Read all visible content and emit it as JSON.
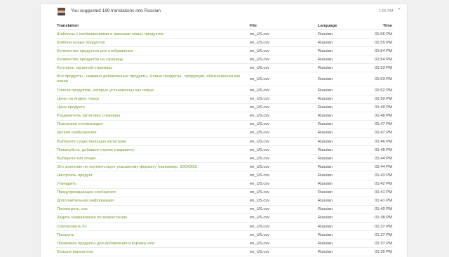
{
  "header": {
    "text": "You suggested 199 translations into Russian",
    "time": "1:56 PM"
  },
  "table": {
    "columns": [
      "Translation",
      "File",
      "Language",
      "Time"
    ],
    "rows": [
      {
        "translation": "Шаблоны с изображениями и именами новых продуктов",
        "file": "en_US.csv",
        "language": "Russian",
        "time": "01:56 PM"
      },
      {
        "translation": "Шаблон новых продуктов",
        "file": "en_US.csv",
        "language": "Russian",
        "time": "01:55 PM"
      },
      {
        "translation": "Количество продуктов для отображения",
        "file": "en_US.csv",
        "language": "Russian",
        "time": "01:54 PM"
      },
      {
        "translation": "Количество продуктов на страницу",
        "file": "en_US.csv",
        "language": "Russian",
        "time": "01:54 PM"
      },
      {
        "translation": "Контроль экранной страницы",
        "file": "en_US.csv",
        "language": "Russian",
        "time": "01:53 PM"
      },
      {
        "translation": "Все продукты - недавно добавленные продукты, Новые продукты - продукция, обозначенная как новая",
        "file": "en_US.csv",
        "language": "Russian",
        "time": "01:53 PM"
      },
      {
        "translation": "Список продуктов, которые установлены как новые",
        "file": "en_US.csv",
        "language": "Russian",
        "time": "01:52 PM"
      },
      {
        "translation": "Цены на индекс товар",
        "file": "en_US.csv",
        "language": "Russian",
        "time": "01:50 PM"
      },
      {
        "translation": "Цена продукта",
        "file": "en_US.csv",
        "language": "Russian",
        "time": "01:49 PM"
      },
      {
        "translation": "Разделитель заголовка страницы",
        "file": "en_US.csv",
        "language": "Russian",
        "time": "01:48 PM"
      },
      {
        "translation": "Поисковая оптимизация",
        "file": "en_US.csv",
        "language": "Russian",
        "time": "01:47 PM"
      },
      {
        "translation": "Детали изображения",
        "file": "en_US.csv",
        "language": "Russian",
        "time": "01:47 PM"
      },
      {
        "translation": "Выберите существующую категорию.",
        "file": "en_US.csv",
        "language": "Russian",
        "time": "01:46 PM"
      },
      {
        "translation": "Пожалуйста, добавьте строки к варианту.",
        "file": "en_US.csv",
        "language": "Russian",
        "time": "01:45 PM"
      },
      {
        "translation": "Выберите тип опции.",
        "file": "en_US.csv",
        "language": "Russian",
        "time": "01:44 PM"
      },
      {
        "translation": "Это значение не соответствует указанному формату (например, 200X300).",
        "file": "en_US.csv",
        "language": "Russian",
        "time": "01:44 PM"
      },
      {
        "translation": "Настроить продукт",
        "file": "en_US.csv",
        "language": "Russian",
        "time": "01:43 PM"
      },
      {
        "translation": "Утвердить",
        "file": "en_US.csv",
        "language": "Russian",
        "time": "01:42 PM"
      },
      {
        "translation": "Предупреждающее сообщение",
        "file": "en_US.csv",
        "language": "Russian",
        "time": "01:41 PM"
      },
      {
        "translation": "Дополнительная информация",
        "file": "en_US.csv",
        "language": "Russian",
        "time": "01:41 PM"
      },
      {
        "translation": "Посмотреть, как",
        "file": "en_US.csv",
        "language": "Russian",
        "time": "01:40 PM"
      },
      {
        "translation": "Задать направление по возрастанию",
        "file": "en_US.csv",
        "language": "Russian",
        "time": "01:38 PM"
      },
      {
        "translation": "Сортировать по",
        "file": "en_US.csv",
        "language": "Russian",
        "time": "01:37 PM"
      },
      {
        "translation": "Показать",
        "file": "en_US.csv",
        "language": "Russian",
        "time": "01:37 PM"
      },
      {
        "translation": "Проверьте продукты для добавления в корзину или",
        "file": "en_US.csv",
        "language": "Russian",
        "time": "01:37 PM"
      },
      {
        "translation": "Больше вариантов:",
        "file": "en_US.csv",
        "language": "Russian",
        "time": "01:35 PM"
      }
    ]
  },
  "icons": {
    "left": "translate-icon",
    "avatar": "user-avatar",
    "collapse": "chevron-up-icon"
  }
}
